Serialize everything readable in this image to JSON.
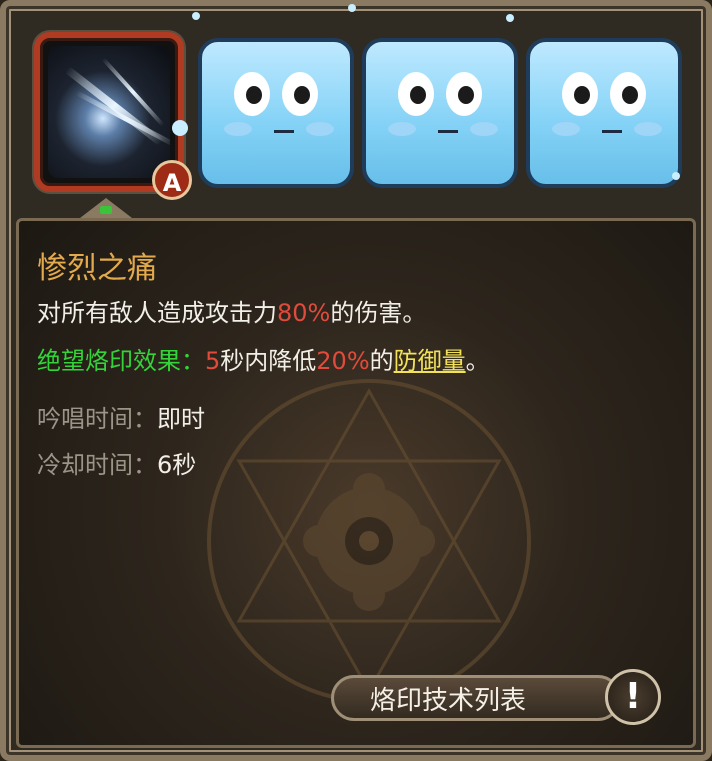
{
  "skill_slots": [
    {
      "kind": "skill-art",
      "selected": true,
      "badge": "A"
    },
    {
      "kind": "ice-face"
    },
    {
      "kind": "ice-face"
    },
    {
      "kind": "ice-face"
    }
  ],
  "skill": {
    "name": "惨烈之痛",
    "desc_prefix": "对所有敌人造成攻击力",
    "desc_value": "80%",
    "desc_suffix": "的伤害。",
    "mark_label": "绝望烙印效果：",
    "mark_duration": "5",
    "mark_mid": "秒内降低",
    "mark_value": "20%",
    "mark_of": "的",
    "mark_stat": "防御量",
    "mark_end": "。",
    "cast_label": "吟唱时间：",
    "cast_value": "即时",
    "cooldown_label": "冷却时间：",
    "cooldown_value": "6秒"
  },
  "list_button_label": "烙印技术列表",
  "info_symbol": "!",
  "colors": {
    "title": "#e2a94d",
    "highlight_red": "#e14b3c",
    "effect_green": "#34d33a",
    "stat_yellow": "#f1e25a"
  }
}
